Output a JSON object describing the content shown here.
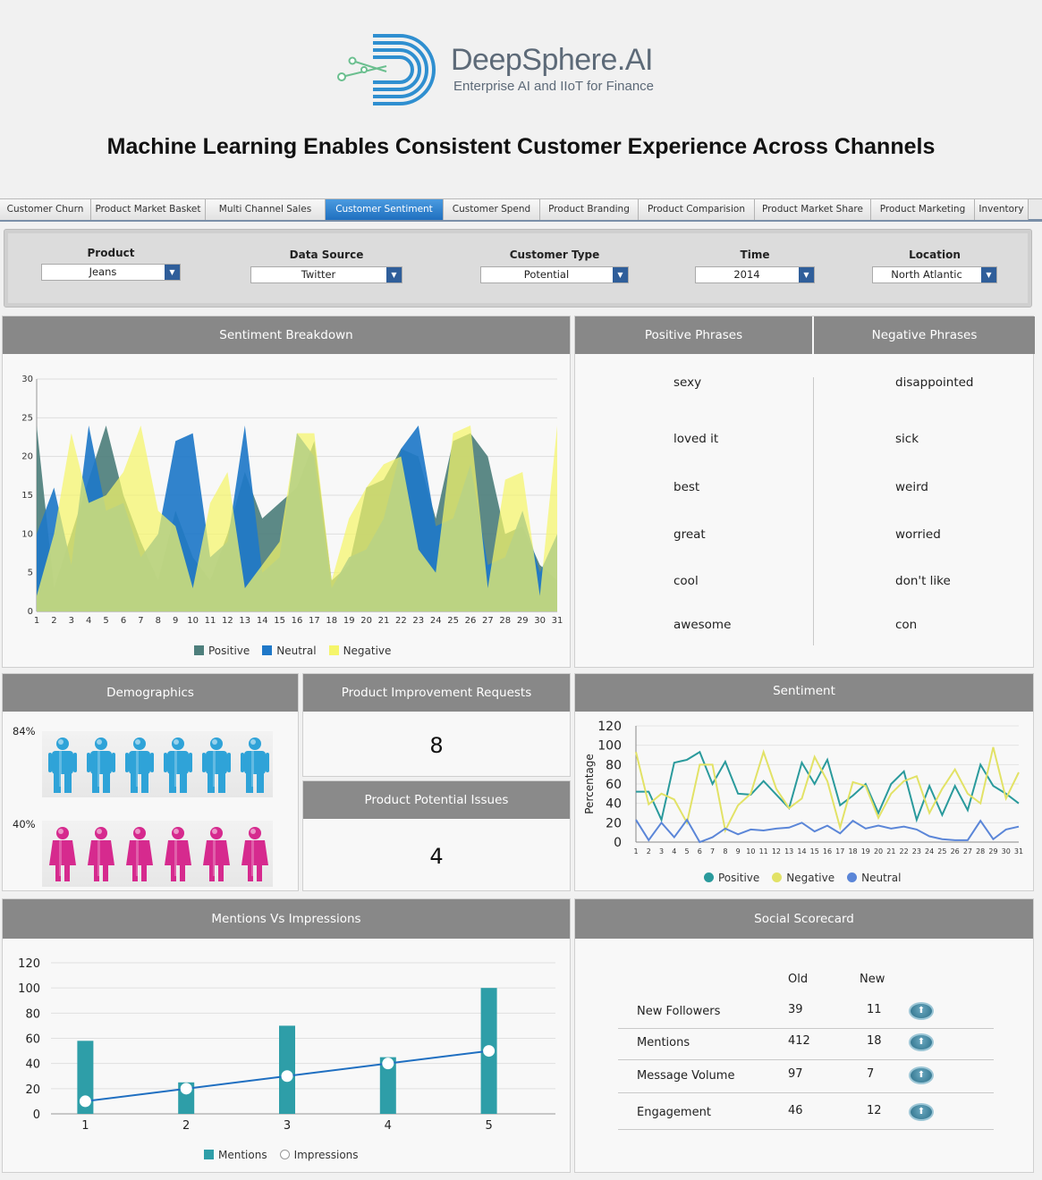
{
  "logo": {
    "name": "DeepSphere.AI",
    "tagline": "Enterprise AI and IIoT for Finance"
  },
  "page_title": "Machine Learning Enables Consistent Customer Experience Across Channels",
  "tabs": [
    {
      "label": "Customer Churn",
      "active": false
    },
    {
      "label": "Product Market Basket",
      "active": false
    },
    {
      "label": "Multi Channel Sales",
      "active": false
    },
    {
      "label": "Customer Sentiment",
      "active": true
    },
    {
      "label": "Customer Spend",
      "active": false
    },
    {
      "label": "Product Branding",
      "active": false
    },
    {
      "label": "Product Comparision",
      "active": false
    },
    {
      "label": "Product Market Share",
      "active": false
    },
    {
      "label": "Product Marketing",
      "active": false
    },
    {
      "label": "Inventory",
      "active": false
    }
  ],
  "filters": [
    {
      "label": "Product",
      "value": "Jeans"
    },
    {
      "label": "Data Source",
      "value": "Twitter"
    },
    {
      "label": "Customer Type",
      "value": "Potential"
    },
    {
      "label": "Time",
      "value": "2014"
    },
    {
      "label": "Location",
      "value": "North Atlantic"
    }
  ],
  "panels": {
    "sentiment_breakdown": "Sentiment Breakdown",
    "positive_phrases": "Positive Phrases",
    "negative_phrases": "Negative Phrases",
    "demographics": "Demographics",
    "improvement_requests": "Product Improvement Requests",
    "potential_issues": "Product Potential Issues",
    "sentiment": "Sentiment",
    "mentions_impressions": "Mentions Vs Impressions",
    "social_scorecard": "Social Scorecard"
  },
  "positive_phrases": [
    "sexy",
    "loved it",
    "best",
    "great",
    "cool",
    "awesome"
  ],
  "negative_phrases": [
    "disappointed",
    "sick",
    "weird",
    "worried",
    "don't like",
    "con"
  ],
  "demographics": {
    "male_pct": "84%",
    "female_pct": "40%",
    "male_color": "#2fa3d8",
    "female_color": "#d62a8e"
  },
  "improvement_requests": "8",
  "potential_issues": "4",
  "scorecard": {
    "col_old": "Old",
    "col_new": "New",
    "rows": [
      {
        "label": "New Followers",
        "old": "39",
        "new": "11"
      },
      {
        "label": "Mentions",
        "old": "412",
        "new": "18"
      },
      {
        "label": "Message Volume",
        "old": "97",
        "new": "7"
      },
      {
        "label": "Engagement",
        "old": "46",
        "new": "12"
      }
    ]
  },
  "chart_data": [
    {
      "type": "area",
      "x": [
        1,
        2,
        3,
        4,
        5,
        6,
        7,
        8,
        9,
        10,
        11,
        12,
        13,
        14,
        15,
        16,
        17,
        18,
        19,
        20,
        21,
        22,
        23,
        24,
        25,
        26,
        27,
        28,
        29,
        30,
        31
      ],
      "ylim": [
        0,
        30
      ],
      "yticks": [
        0,
        5,
        10,
        15,
        20,
        25,
        30
      ],
      "series": [
        {
          "name": "Positive",
          "color": "#4e7f7c",
          "values": [
            24,
            3,
            10,
            17,
            24,
            15,
            9,
            4,
            13,
            7,
            4,
            10,
            18,
            12,
            14,
            16,
            22,
            4,
            6,
            16,
            17,
            21,
            20,
            12,
            22,
            23,
            20,
            10,
            11,
            6,
            4
          ]
        },
        {
          "name": "Neutral",
          "color": "#1f78c8",
          "values": [
            10,
            16,
            6,
            24,
            13,
            14,
            7,
            10,
            22,
            23,
            7,
            9,
            24,
            5,
            7,
            23,
            20,
            3,
            7,
            8,
            12,
            21,
            24,
            11,
            12,
            19,
            6,
            7,
            13,
            5,
            10
          ]
        },
        {
          "name": "Negative",
          "color": "#f5f56a",
          "values": [
            2,
            10,
            23,
            14,
            15,
            18,
            24,
            13,
            11,
            3,
            14,
            18,
            3,
            6,
            9,
            23,
            23,
            4,
            12,
            16,
            19,
            20,
            8,
            5,
            23,
            24,
            3,
            17,
            18,
            2,
            24
          ]
        }
      ],
      "legend": "bottom"
    },
    {
      "type": "line",
      "x": [
        1,
        2,
        3,
        4,
        5,
        6,
        7,
        8,
        9,
        10,
        11,
        12,
        13,
        14,
        15,
        16,
        17,
        18,
        19,
        20,
        21,
        22,
        23,
        24,
        25,
        26,
        27,
        28,
        29,
        30,
        31
      ],
      "ylabel": "Percentage",
      "ylim": [
        0,
        120
      ],
      "yticks": [
        0,
        20,
        40,
        60,
        80,
        100,
        120
      ],
      "series": [
        {
          "name": "Positive",
          "color": "#2a9a9c",
          "values": [
            52,
            52,
            23,
            82,
            85,
            93,
            60,
            83,
            50,
            49,
            63,
            49,
            35,
            82,
            60,
            85,
            38,
            48,
            60,
            30,
            60,
            73,
            23,
            58,
            28,
            58,
            33,
            80,
            58,
            50,
            40
          ]
        },
        {
          "name": "Negative",
          "color": "#e2e266",
          "values": [
            93,
            39,
            50,
            44,
            20,
            80,
            80,
            12,
            38,
            50,
            93,
            55,
            35,
            45,
            88,
            63,
            15,
            62,
            58,
            25,
            50,
            63,
            68,
            30,
            55,
            75,
            50,
            40,
            98,
            45,
            72
          ]
        },
        {
          "name": "Neutral",
          "color": "#5b86d8",
          "values": [
            23,
            2,
            20,
            5,
            23,
            0,
            5,
            14,
            8,
            13,
            12,
            14,
            15,
            20,
            11,
            17,
            9,
            22,
            14,
            17,
            14,
            16,
            13,
            6,
            3,
            2,
            2,
            22,
            3,
            13,
            16
          ]
        }
      ],
      "legend": "bottom"
    },
    {
      "type": "bar",
      "categories": [
        "1",
        "2",
        "3",
        "4",
        "5"
      ],
      "ylim": [
        0,
        120
      ],
      "yticks": [
        0,
        20,
        40,
        60,
        80,
        100,
        120
      ],
      "series": [
        {
          "name": "Mentions",
          "type": "bar",
          "color": "#2e9ea8",
          "values": [
            58,
            25,
            70,
            45,
            100
          ]
        },
        {
          "name": "Impressions",
          "type": "line",
          "color": "#1f6fc1",
          "values": [
            10,
            20,
            30,
            40,
            50
          ]
        }
      ],
      "legend": "bottom"
    }
  ]
}
